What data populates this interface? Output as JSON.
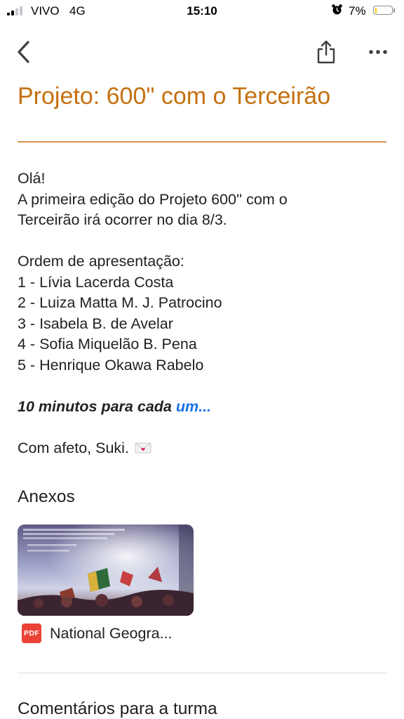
{
  "status_bar": {
    "carrier": "VIVO",
    "network": "4G",
    "time": "15:10",
    "battery_percent": "7%",
    "battery_level": 0.07,
    "battery_color": "#ffcc00",
    "signal_bars_active": 2,
    "alarm_icon": "alarm-clock-icon"
  },
  "toolbar": {
    "back_icon": "chevron-left-icon",
    "share_icon": "share-icon",
    "more_icon": "more-horizontal-icon"
  },
  "post": {
    "title": "Projeto: 600\" com o Terceirão",
    "accent_color": "#c5700f",
    "greeting": "Olá!",
    "intro_line1": "A primeira edição do Projeto 600'' com o",
    "intro_line2": "Terceirão irá ocorrer no dia 8/3.",
    "order_heading": "Ordem de apresentação:",
    "order": [
      "1 - Lívia Lacerda Costa",
      "2 - Luiza Matta M. J. Patrocino",
      "3 - Isabela B. de Avelar",
      "4 - Sofia Miquelão B. Pena",
      "5 - Henrique Okawa Rabelo"
    ],
    "emphasis": "10 minutos para cada",
    "more_link": "um...",
    "signoff": "Com afeto, Suki.",
    "signoff_emoji": "love-letter-icon"
  },
  "attachments": {
    "heading": "Anexos",
    "items": [
      {
        "type_badge": "PDF",
        "name": "National Geogra..."
      }
    ]
  },
  "comments": {
    "heading": "Comentários para a turma"
  }
}
